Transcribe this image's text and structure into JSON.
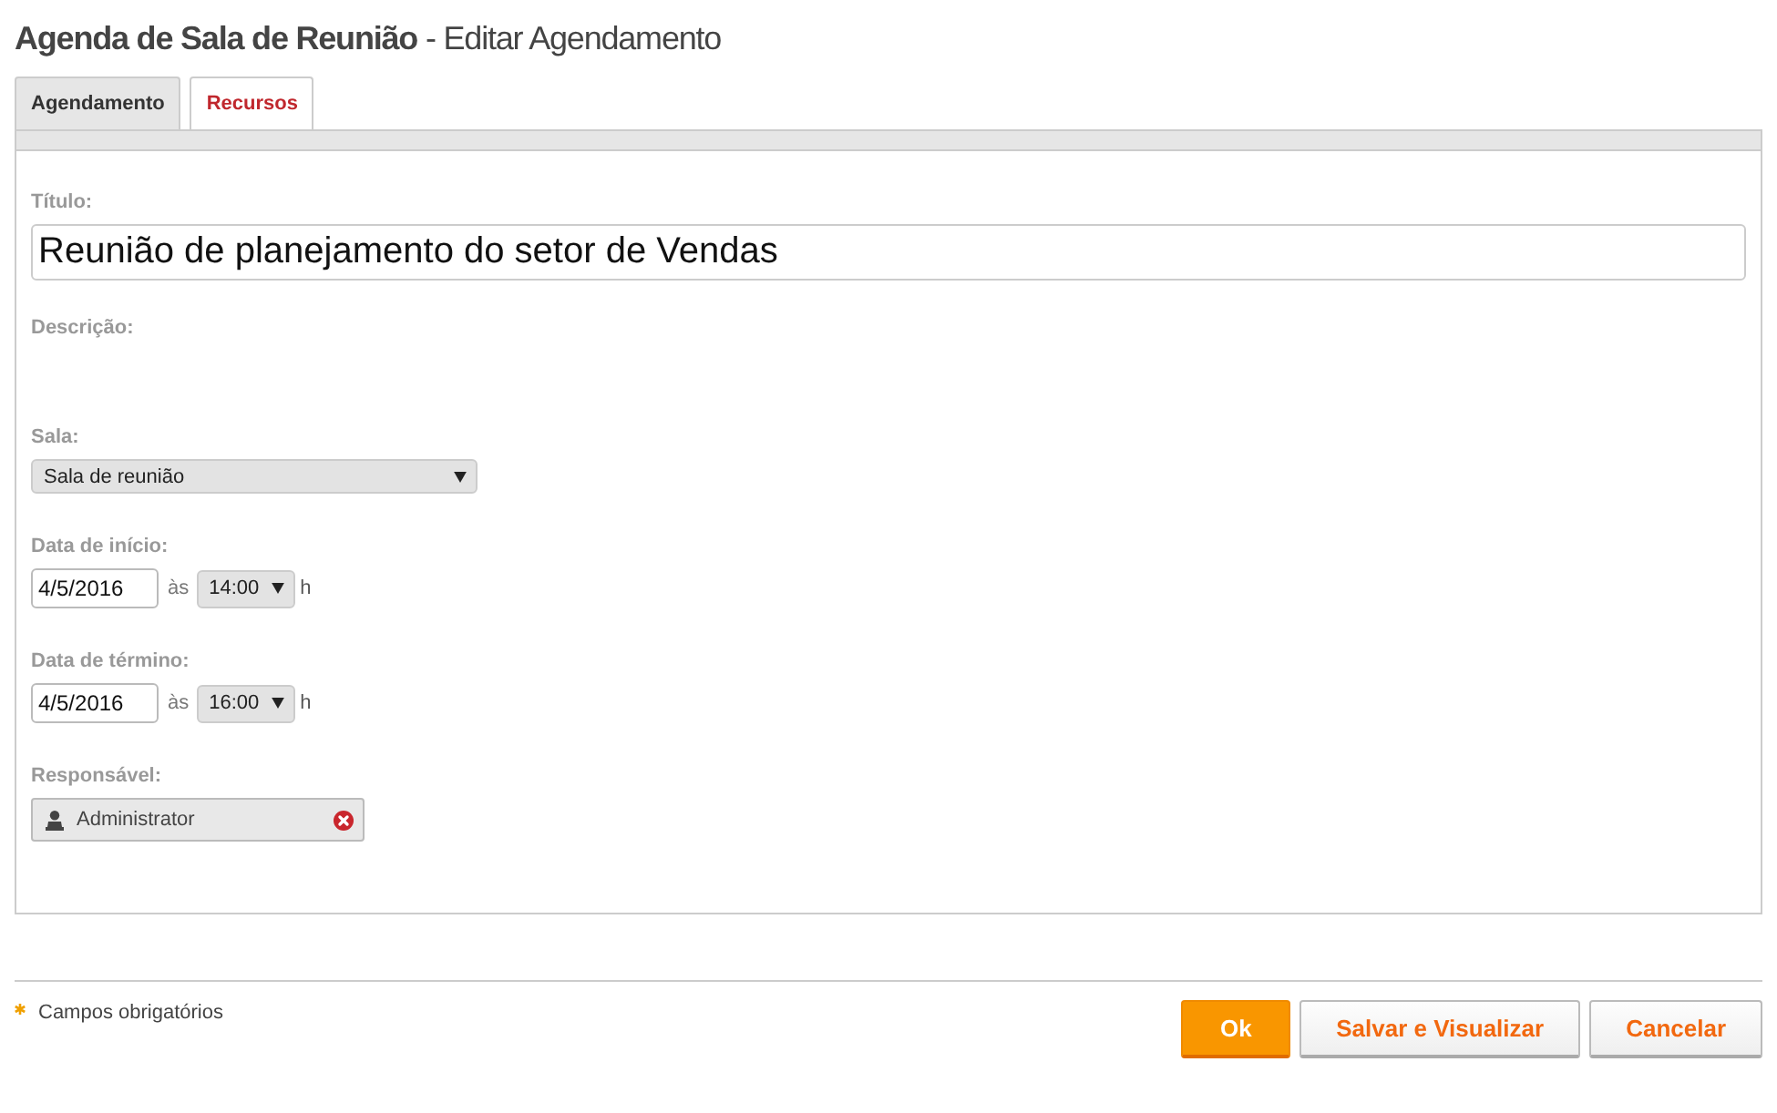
{
  "page_title": "**Agenda de Sala de Reunião** - Editar Agendamento",
  "tabs": [
    {
      "label": "Agendamento",
      "selected": true
    },
    {
      "label": "Recursos",
      "selected": false
    }
  ],
  "form": {
    "title": {
      "label": "Título:",
      "value": "Reunião de planejamento do setor de Vendas"
    },
    "description": {
      "label": "Descrição:"
    },
    "room": {
      "label": "Sala:",
      "value": "Sala de reunião"
    },
    "schedule": [
      {
        "label": "Data de início:",
        "date": "4/5/2016",
        "connector": "às",
        "time": "14:00",
        "unit": "h"
      },
      {
        "label": "Data de término:",
        "date": "4/5/2016",
        "connector": "às",
        "time": "16:00",
        "unit": "h"
      }
    ],
    "responsible": {
      "label": "Responsável:",
      "people": [
        {
          "name": "Administrator"
        }
      ]
    }
  },
  "footer": {
    "required_note": "Campos obrigatórios",
    "buttons": [
      {
        "label": "Ok",
        "kind": "primary"
      },
      {
        "label": "Salvar e Visualizar",
        "kind": "secondary"
      },
      {
        "label": "Cancelar",
        "kind": "secondary"
      }
    ]
  }
}
